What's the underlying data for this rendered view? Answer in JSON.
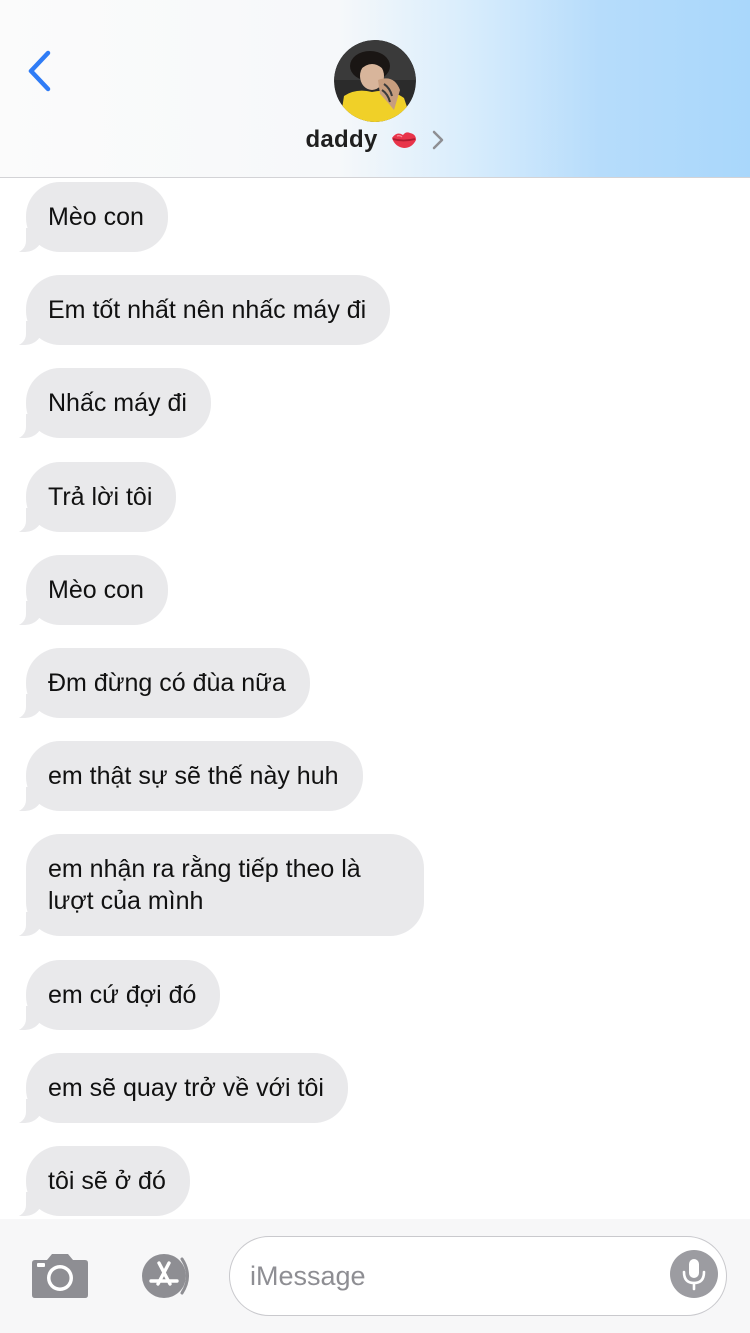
{
  "header": {
    "contact_name": "daddy"
  },
  "icons": {
    "back": "chevron-left-icon",
    "avatar": "contact-avatar",
    "emoji": "kiss-mark-icon",
    "details": "chevron-right-icon",
    "camera": "camera-icon",
    "apps": "app-store-icon",
    "mic": "microphone-icon"
  },
  "colors": {
    "accent": "#2f7cf6",
    "bubble_received": "#e9e9eb",
    "kiss_mark": "#e8344a"
  },
  "messages": [
    {
      "sender": "contact",
      "text": "Mèo con"
    },
    {
      "sender": "contact",
      "text": "Em tốt nhất nên nhấc máy đi"
    },
    {
      "sender": "contact",
      "text": "Nhấc máy đi"
    },
    {
      "sender": "contact",
      "text": "Trả lời tôi"
    },
    {
      "sender": "contact",
      "text": "Mèo con"
    },
    {
      "sender": "contact",
      "text": "Đm đừng có đùa nữa"
    },
    {
      "sender": "contact",
      "text": "em thật sự sẽ thế này huh"
    },
    {
      "sender": "contact",
      "text": "em nhận ra rằng tiếp theo là lượt của mình"
    },
    {
      "sender": "contact",
      "text": "em cứ đợi đó"
    },
    {
      "sender": "contact",
      "text": "em sẽ quay trở về với tôi"
    },
    {
      "sender": "contact",
      "text": "tôi sẽ ở đó"
    }
  ],
  "composer": {
    "placeholder": "iMessage",
    "value": ""
  }
}
